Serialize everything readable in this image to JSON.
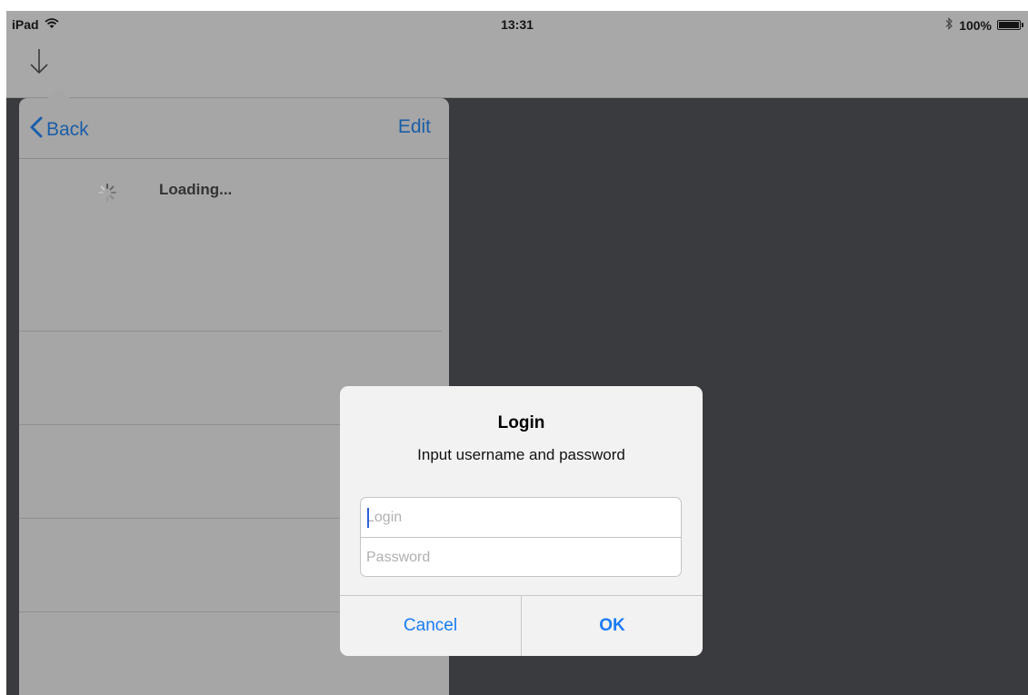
{
  "status_bar": {
    "carrier": "iPad",
    "time": "13:31",
    "battery": "100%",
    "icons": [
      "wifi-icon",
      "bluetooth-icon",
      "battery-icon"
    ]
  },
  "toolbar": {
    "icon": "down-arrow-icon"
  },
  "popover": {
    "back_label": "Back",
    "edit_label": "Edit",
    "loading_text": "Loading...",
    "accent_color": "#1a5ea8"
  },
  "alert": {
    "title": "Login",
    "message": "Input username and password",
    "login_placeholder": "Login",
    "login_value": "",
    "password_placeholder": "Password",
    "password_value": "",
    "cancel_label": "Cancel",
    "ok_label": "OK",
    "button_color": "#1a7cf5"
  }
}
